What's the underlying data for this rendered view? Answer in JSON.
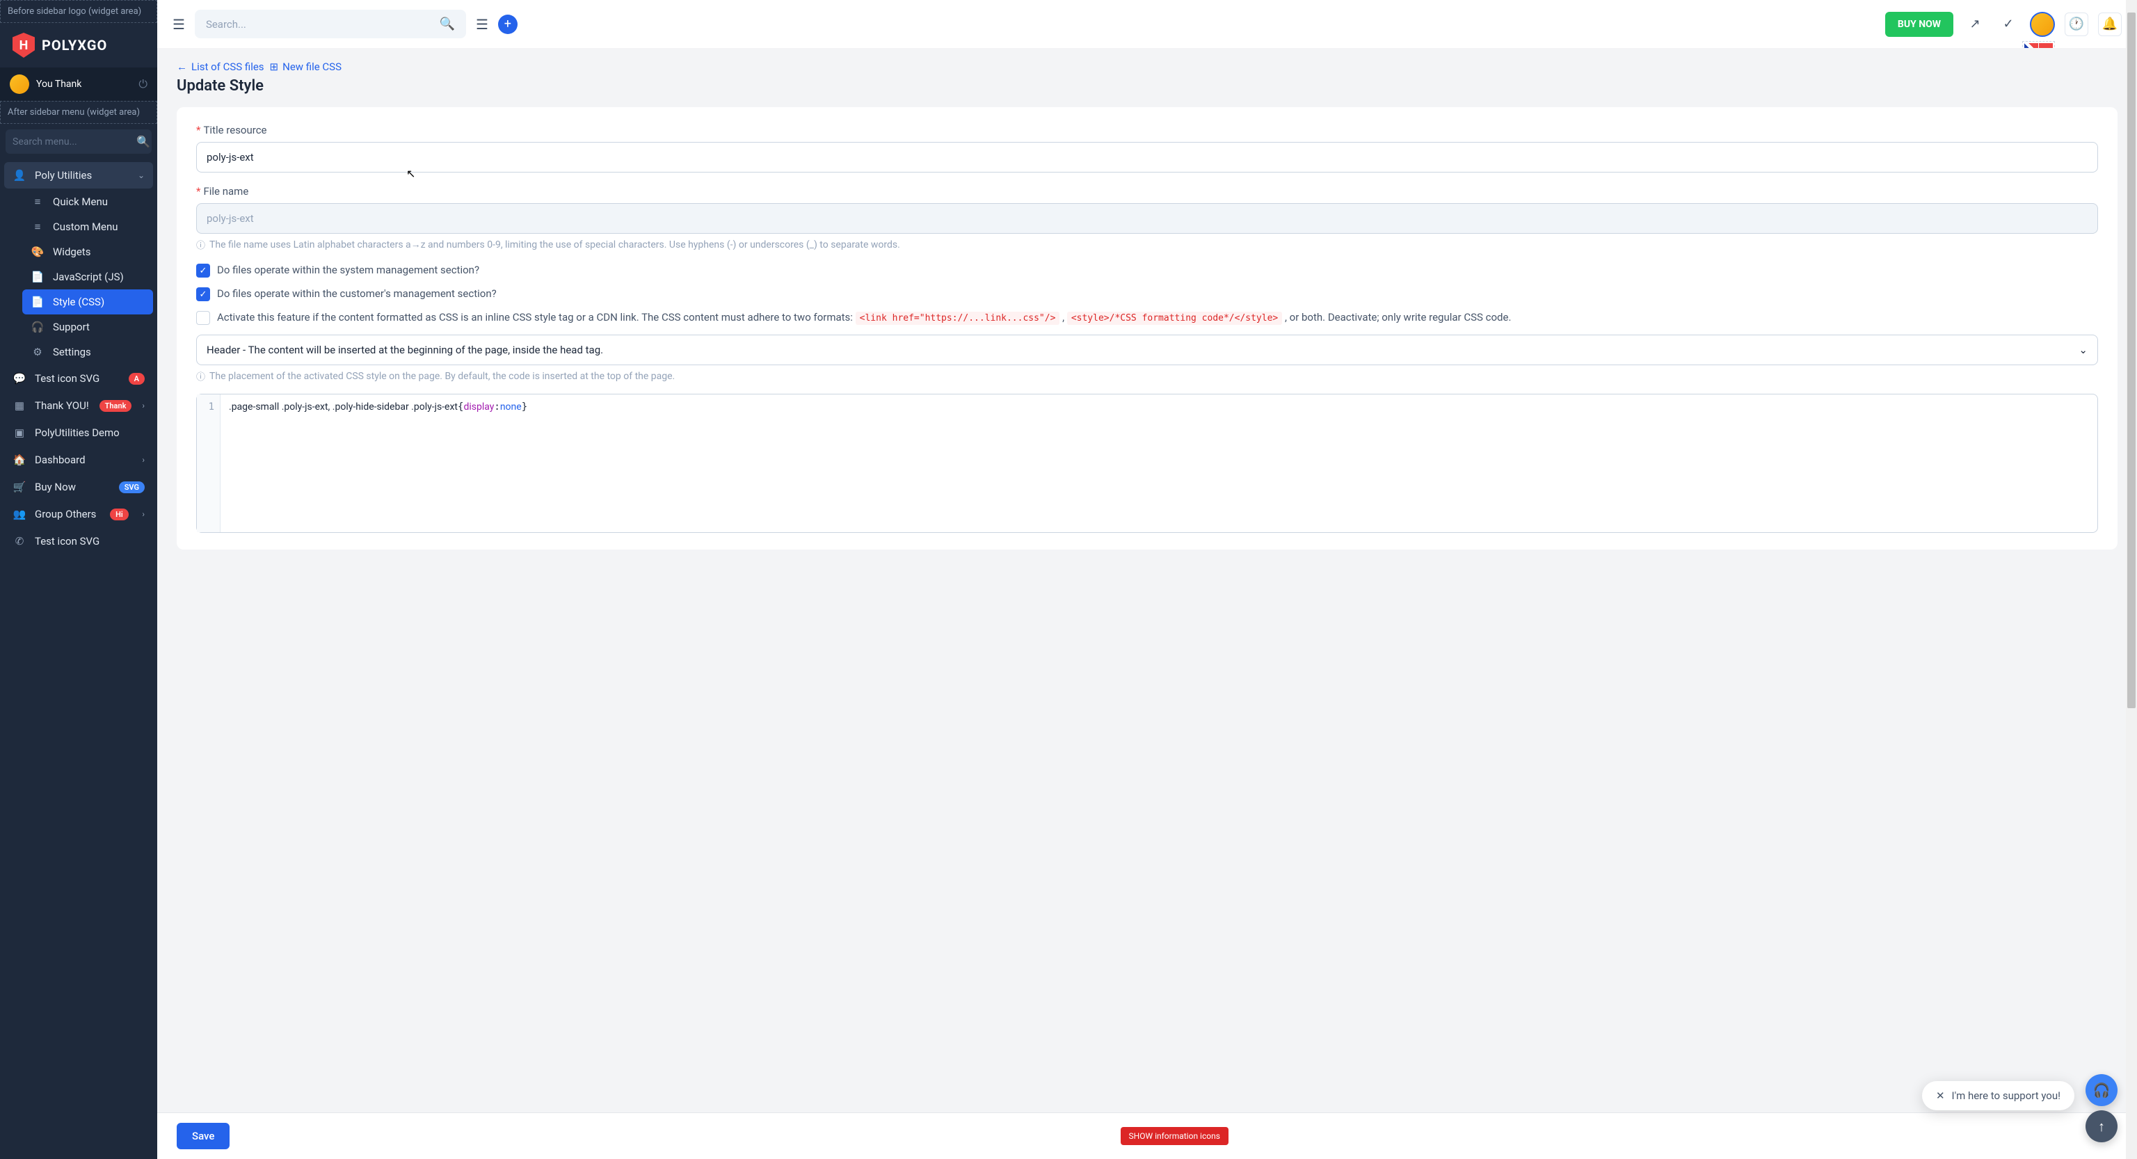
{
  "sidebar": {
    "before_logo_placeholder": "Before sidebar logo (widget area)",
    "logo_text": "POLYXGO",
    "logo_letter": "H",
    "user_name": "You Thank",
    "after_menu_placeholder": "After sidebar menu (widget area)",
    "search_placeholder": "Search menu...",
    "poly_utilities": "Poly Utilities",
    "sub_items": {
      "quick_menu": "Quick Menu",
      "custom_menu": "Custom Menu",
      "widgets": "Widgets",
      "javascript": "JavaScript (JS)",
      "style_css": "Style (CSS)",
      "support": "Support",
      "settings": "Settings"
    },
    "items": {
      "test_icon_svg": "Test icon SVG",
      "test_icon_svg_badge": "A",
      "thank_you": "Thank YOU!",
      "thank_you_badge": "Thank",
      "polyutilities_demo": "PolyUtilities Demo",
      "dashboard": "Dashboard",
      "buy_now": "Buy Now",
      "buy_now_badge": "SVG",
      "group_others": "Group Others",
      "group_others_badge": "Hi",
      "test_icon_svg2": "Test icon SVG"
    }
  },
  "topbar": {
    "search_placeholder": "Search...",
    "buy_now": "BUY NOW"
  },
  "breadcrumb": {
    "list_css": "List of CSS files",
    "new_file": "New file CSS"
  },
  "page": {
    "title": "Update Style"
  },
  "form": {
    "title_resource_label": "Title resource",
    "title_resource_value": "poly-js-ext",
    "file_name_label": "File name",
    "file_name_value": "poly-js-ext",
    "file_name_help": "The file name uses Latin alphabet characters a→z and numbers 0-9, limiting the use of special characters. Use hyphens (-) or underscores (_) to separate words.",
    "check1": "Do files operate within the system management section?",
    "check2": "Do files operate within the customer's management section?",
    "check3_prefix": "Activate this feature if the content formatted as CSS is an inline CSS style tag or a CDN link. The CSS content must adhere to two formats: ",
    "check3_code1": "<link href=\"https://...link...css\"/>",
    "check3_mid": " , ",
    "check3_code2": "<style>/*CSS formatting code*/</style>",
    "check3_suffix": " , or both. Deactivate; only write regular CSS code.",
    "select_value": "Header - The content will be inserted at the beginning of the page, inside the head tag.",
    "select_help": "The placement of the activated CSS style on the page. By default, the code is inserted at the top of the page.",
    "code_line_num": "1",
    "code_line": ".page-small .poly-js-ext, .poly-hide-sidebar .poly-js-ext{display:none}"
  },
  "footer": {
    "save": "Save",
    "show_info": "SHOW information icons"
  },
  "support_bubble": "I'm here to support you!"
}
